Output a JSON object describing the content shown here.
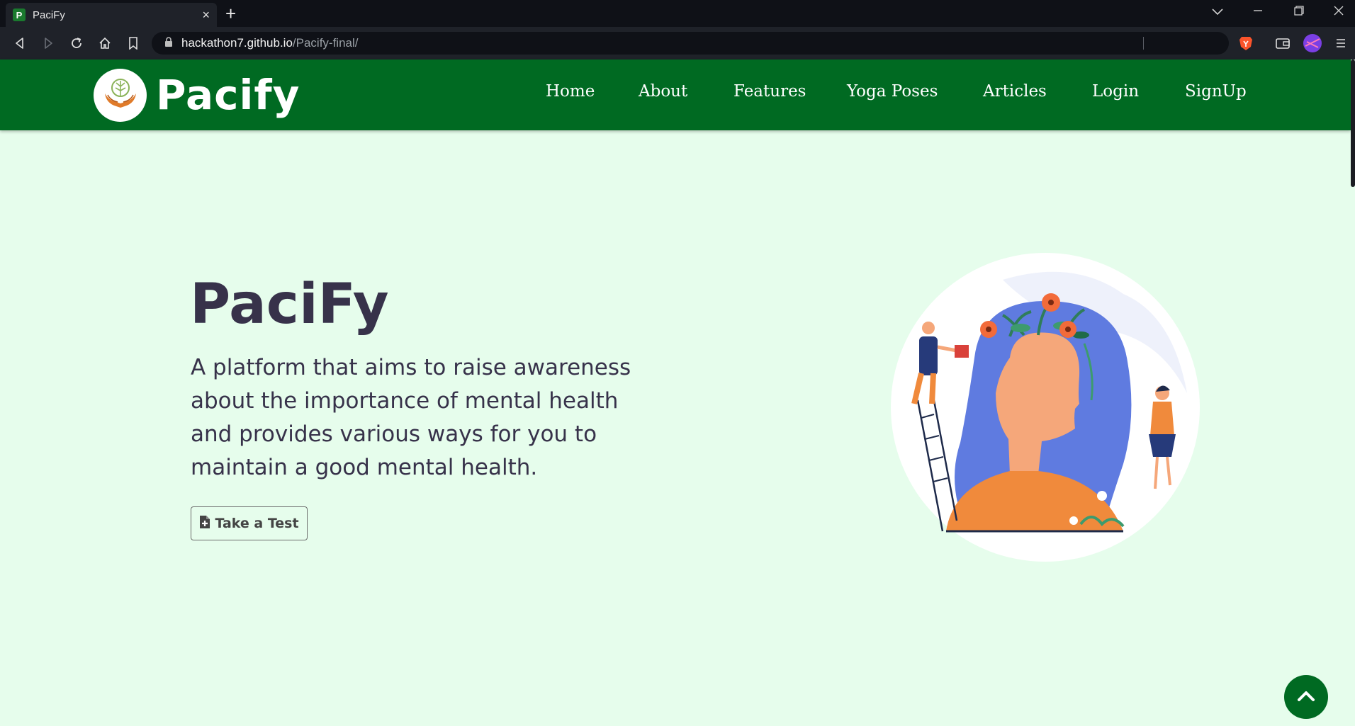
{
  "browser": {
    "tab_title": "PaciFy",
    "tab_favicon_letter": "P",
    "tab_close": "×",
    "new_tab": "+",
    "url_host": "hackathon7.github.io",
    "url_path": "/Pacify-final/"
  },
  "navbar": {
    "brand": "Pacify",
    "links": [
      "Home",
      "About",
      "Features",
      "Yoga Poses",
      "Articles",
      "Login",
      "SignUp"
    ]
  },
  "hero": {
    "title": "PaciFy",
    "description": "A platform that aims to raise awareness about the importance of mental health and provides various ways for you to maintain a good mental health.",
    "cta_label": "Take a Test"
  },
  "colors": {
    "navbar": "#006a22",
    "background": "#e6fdec",
    "heading": "#37324a"
  },
  "icons": [
    "back-icon",
    "forward-icon",
    "reload-icon",
    "home-icon",
    "bookmark-icon",
    "lock-icon",
    "brave-shield-icon",
    "wallet-icon",
    "profile-icon",
    "menu-icon",
    "file-medical-icon",
    "chevron-up-icon"
  ]
}
